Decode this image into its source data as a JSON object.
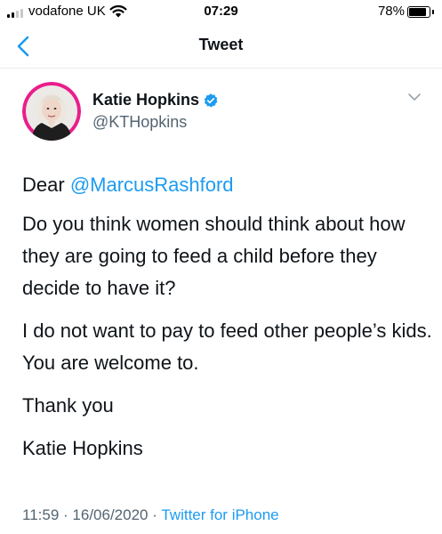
{
  "status_bar": {
    "carrier": "vodafone UK",
    "time": "07:29",
    "battery_percent": "78%",
    "battery_level": 0.78,
    "signal_bars_active": 2,
    "signal_bars_total": 4,
    "icons": [
      "signal-icon",
      "wifi-icon",
      "battery-icon"
    ]
  },
  "nav": {
    "title": "Tweet",
    "back_icon": "chevron-left-icon",
    "accent_color": "#1d9bf0"
  },
  "tweet": {
    "author": {
      "name": "Katie Hopkins",
      "handle": "@KTHopkins",
      "verified": true,
      "avatar_ring_color": "#e91e8c"
    },
    "mention": "@MarcusRashford",
    "salutation": "Dear",
    "paragraphs": [
      "Do you think women should think about how they are going to feed a child before they decide to have it?",
      "I do not want to pay to feed other people’s kids. You are welcome to.",
      "Thank you",
      "Katie Hopkins"
    ],
    "time": "11:59",
    "separator": "·",
    "date": "16/06/2020",
    "source": "Twitter for iPhone"
  }
}
